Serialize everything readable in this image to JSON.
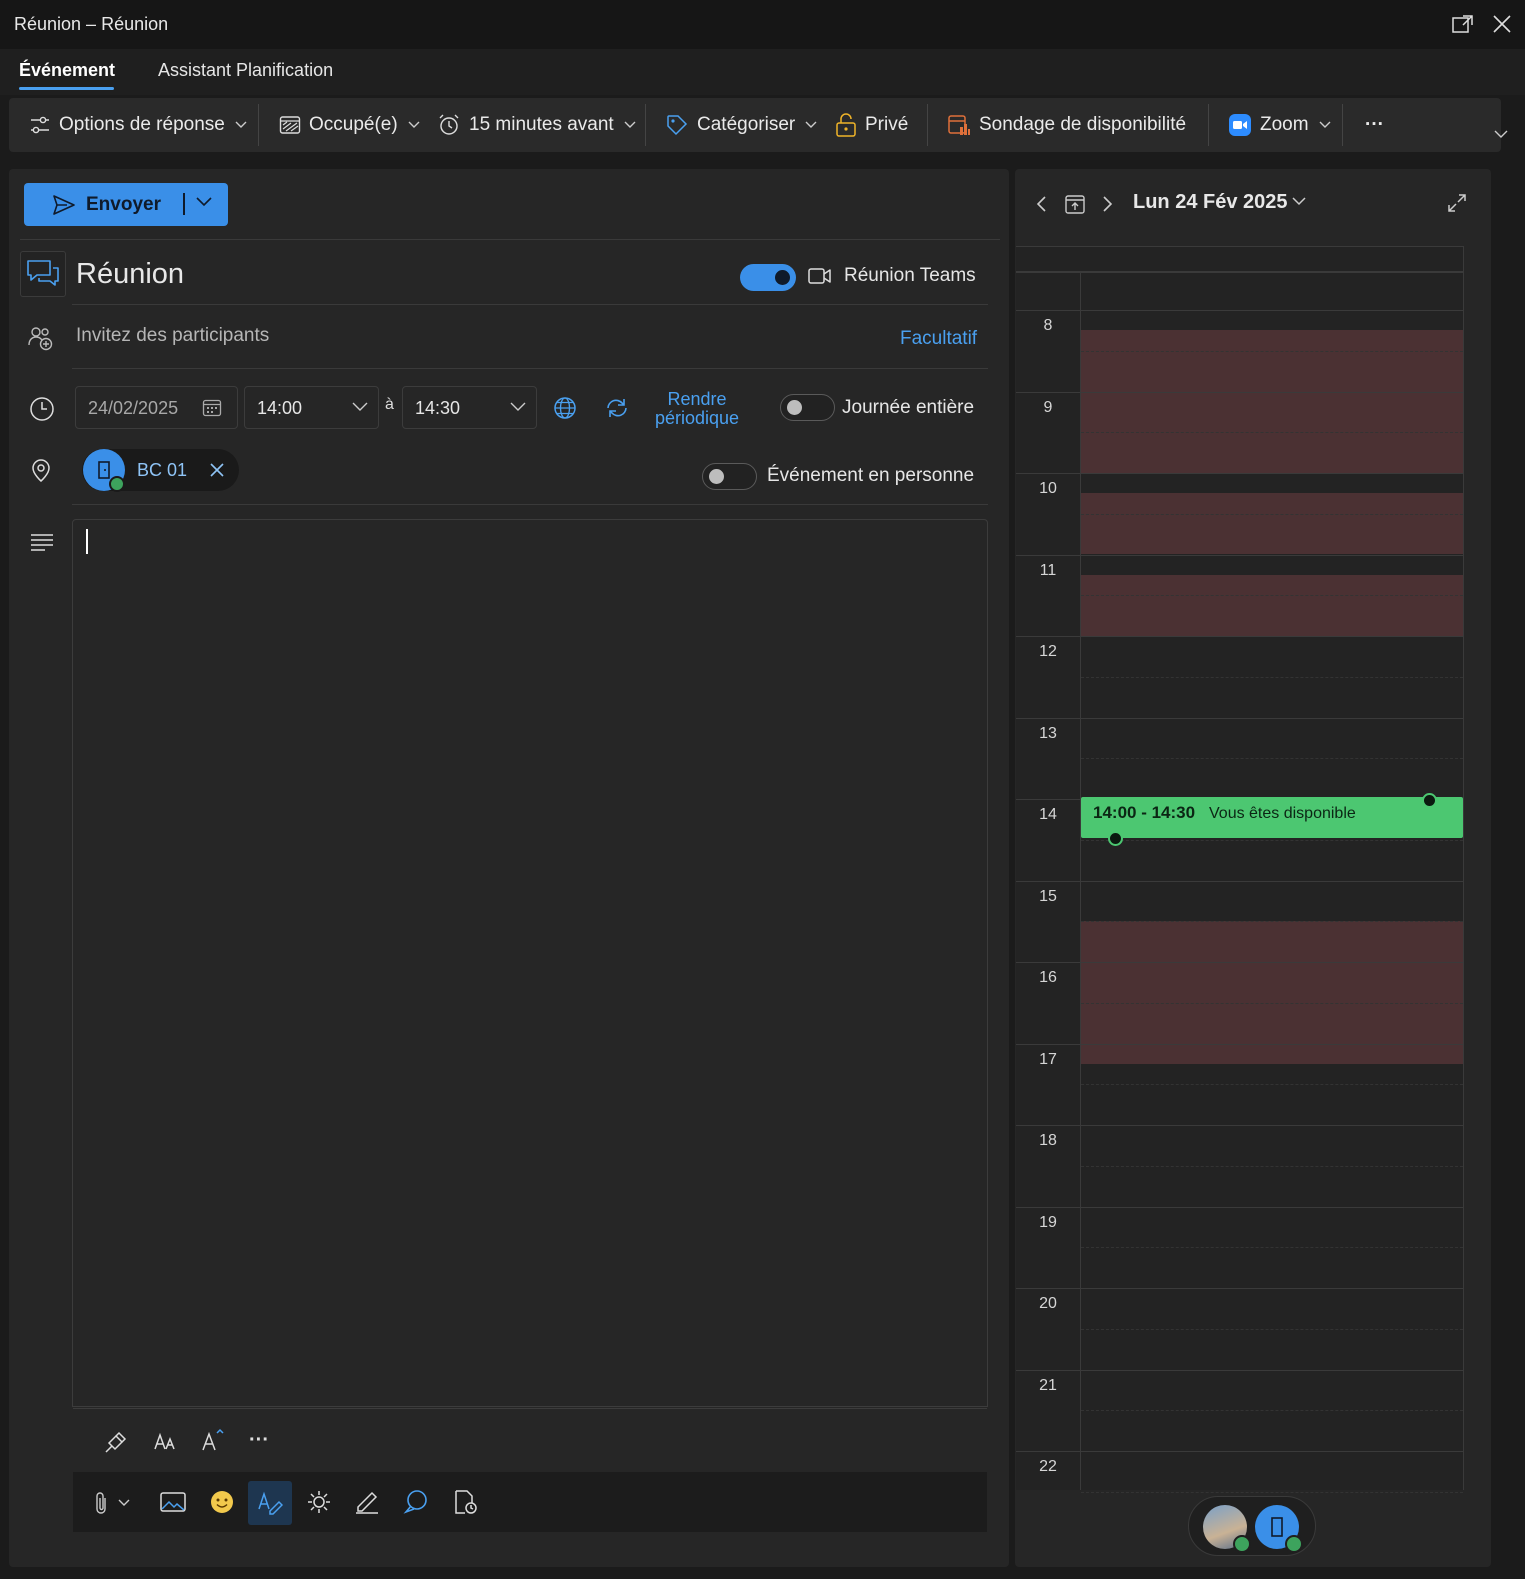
{
  "window": {
    "title": "Réunion – Réunion"
  },
  "tabs": [
    {
      "label": "Événement",
      "active": true
    },
    {
      "label": "Assistant Planification",
      "active": false
    }
  ],
  "ribbon": {
    "response_options": "Options de réponse",
    "show_as": "Occupé(e)",
    "reminder": "15 minutes avant",
    "categorize": "Catégoriser",
    "private": "Privé",
    "availability_poll": "Sondage de disponibilité",
    "zoom": "Zoom",
    "more": "···"
  },
  "form": {
    "send_label": "Envoyer",
    "subject": "Réunion",
    "teams_meeting": {
      "label": "Réunion Teams",
      "enabled": true
    },
    "attendees": {
      "placeholder": "Invitez des participants",
      "optional_label": "Facultatif"
    },
    "date": "24/02/2025",
    "start_time": "14:00",
    "to_label": "à",
    "end_time": "14:30",
    "recurrence_label": [
      "Rendre",
      "périodique"
    ],
    "all_day": {
      "label": "Journée entière",
      "enabled": false
    },
    "location": {
      "room": "BC 01"
    },
    "in_person": {
      "label": "Événement en personne",
      "enabled": false
    },
    "body": ""
  },
  "calendar": {
    "date_label": "Lun 24 Fév 2025",
    "hours": [
      "8",
      "9",
      "10",
      "11",
      "12",
      "13",
      "14",
      "15",
      "16",
      "17",
      "18",
      "19",
      "20",
      "21",
      "22"
    ],
    "busy_blocks": [
      {
        "start": "8:00",
        "end": "9:45"
      },
      {
        "start": "10:00",
        "end": "10:45"
      },
      {
        "start": "11:00",
        "end": "11:45"
      },
      {
        "start": "15:15",
        "end": "17:00"
      }
    ],
    "event": {
      "time": "14:00 - 14:30",
      "status": "Vous êtes disponible"
    }
  },
  "colors": {
    "accent": "#3a8fe8",
    "link": "#4aa0f0",
    "busy": "#4b3133",
    "available": "#4cc771",
    "background": "#1b1b1b"
  },
  "icons": {
    "response_options": "sliders-icon",
    "show_as": "busy-status-icon",
    "reminder": "alarm-clock-icon",
    "categorize": "tag-icon",
    "private": "lock-icon",
    "availability_poll": "poll-icon",
    "zoom": "zoom-camera-icon"
  }
}
